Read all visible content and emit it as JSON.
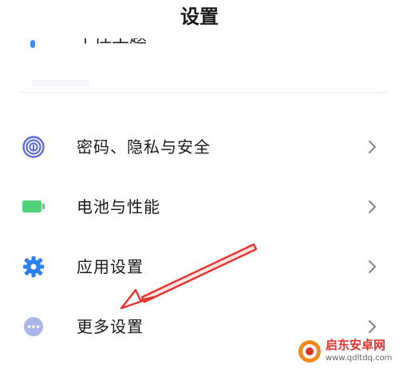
{
  "header": {
    "title": "设置"
  },
  "partial_row": {
    "label": "个性主题"
  },
  "settings": {
    "items": [
      {
        "label": "密码、隐私与安全",
        "icon": "fingerprint-icon"
      },
      {
        "label": "电池与性能",
        "icon": "battery-icon"
      },
      {
        "label": "应用设置",
        "icon": "gear-icon"
      },
      {
        "label": "更多设置",
        "icon": "more-dots-icon"
      }
    ]
  },
  "watermark": {
    "text": "启东安卓网",
    "url": "www.qdltdq.com"
  },
  "colors": {
    "fingerprint": "#5c6bd6",
    "battery": "#4fd27a",
    "gear": "#2b7ff2",
    "more": "#a8b6e8",
    "annotation_arrow": "#e8332f",
    "chevron": "#8a8a8a"
  }
}
